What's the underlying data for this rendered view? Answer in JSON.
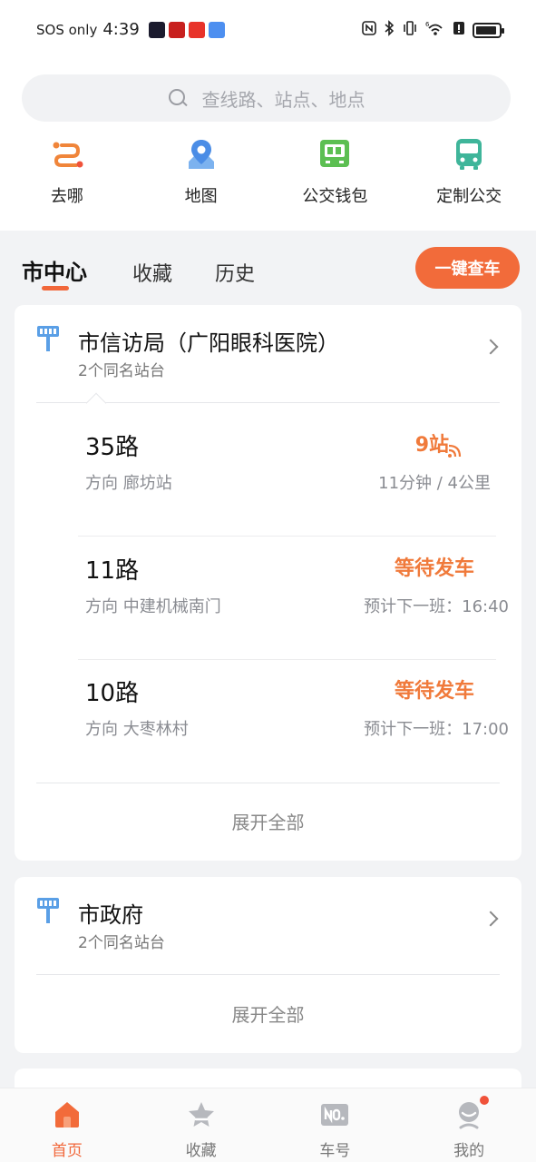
{
  "status_bar": {
    "carrier": "SOS only",
    "time": "4:39",
    "signal_text": "6"
  },
  "search": {
    "placeholder": "查线路、站点、地点"
  },
  "quick_actions": [
    {
      "label": "去哪",
      "icon": "route-icon"
    },
    {
      "label": "地图",
      "icon": "map-pin-icon"
    },
    {
      "label": "公交钱包",
      "icon": "bus-wallet-icon"
    },
    {
      "label": "定制公交",
      "icon": "bus-icon"
    }
  ],
  "tabs": [
    {
      "label": "市中心",
      "active": true
    },
    {
      "label": "收藏",
      "active": false
    },
    {
      "label": "历史",
      "active": false
    }
  ],
  "check_bus_label": "一键查车",
  "stations": [
    {
      "name": "市信访局（广阳眼科医院）",
      "sub": "2个同名站台",
      "routes": [
        {
          "name": "35路",
          "direction": "方向 廊坊站",
          "status": "9站",
          "eta": "11分钟 / 4公里",
          "realtime": true
        },
        {
          "name": "11路",
          "direction": "方向 中建机械南门",
          "status": "等待发车",
          "eta": "预计下一班：16:40",
          "realtime": false
        },
        {
          "name": "10路",
          "direction": "方向 大枣林村",
          "status": "等待发车",
          "eta": "预计下一班：17:00",
          "realtime": false
        }
      ],
      "expand_label": "展开全部"
    },
    {
      "name": "市政府",
      "sub": "2个同名站台",
      "routes": [],
      "expand_label": "展开全部"
    }
  ],
  "bottom_nav": [
    {
      "label": "首页",
      "icon": "home-icon",
      "active": true
    },
    {
      "label": "收藏",
      "icon": "star-icon",
      "active": false
    },
    {
      "label": "车号",
      "icon": "bus-number-icon",
      "active": false
    },
    {
      "label": "我的",
      "icon": "profile-icon",
      "active": false
    }
  ],
  "colors": {
    "accent": "#f26b3a",
    "status_orange": "#f07a3b",
    "stop_icon_blue": "#5a9fe6"
  }
}
